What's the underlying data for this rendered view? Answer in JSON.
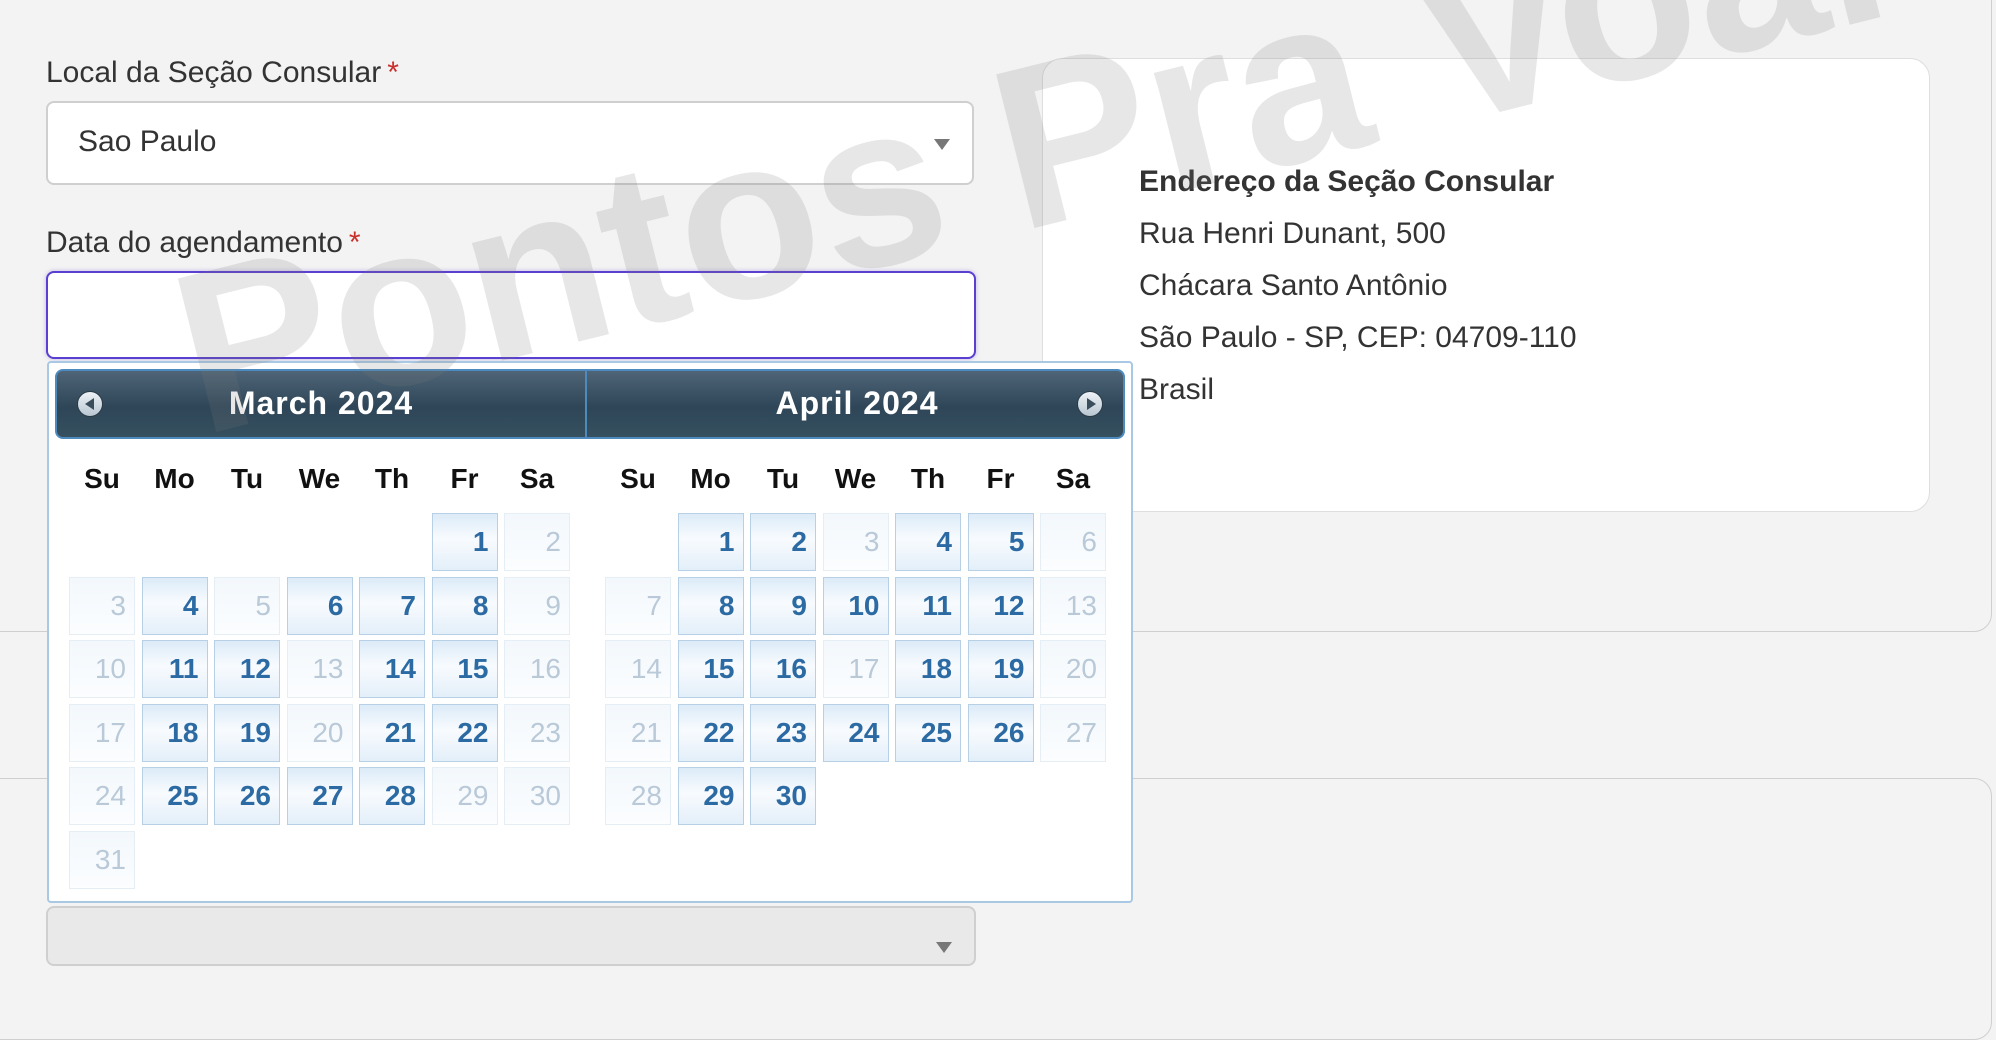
{
  "form": {
    "local_label": "Local da Seção Consular",
    "local_required": "*",
    "local_value": "Sao Paulo",
    "date_label": "Data do agendamento",
    "date_required": "*",
    "date_value": ""
  },
  "address": {
    "title": "Endereço da Seção Consular",
    "line1": "Rua Henri Dunant, 500",
    "line2": "Chácara Santo Antônio",
    "line3": "São Paulo - SP, CEP: 04709-110",
    "line4": "Brasil"
  },
  "datepicker": {
    "weekdays": [
      "Su",
      "Mo",
      "Tu",
      "We",
      "Th",
      "Fr",
      "Sa"
    ],
    "months": [
      {
        "title": "March 2024",
        "weeks": [
          [
            null,
            null,
            null,
            null,
            null,
            1,
            2
          ],
          [
            3,
            4,
            5,
            6,
            7,
            8,
            9
          ],
          [
            10,
            11,
            12,
            13,
            14,
            15,
            16
          ],
          [
            17,
            18,
            19,
            20,
            21,
            22,
            23
          ],
          [
            24,
            25,
            26,
            27,
            28,
            29,
            30
          ],
          [
            31,
            null,
            null,
            null,
            null,
            null,
            null
          ]
        ],
        "available": [
          1,
          4,
          6,
          7,
          8,
          11,
          12,
          14,
          15,
          18,
          19,
          21,
          22,
          25,
          26,
          27,
          28
        ]
      },
      {
        "title": "April 2024",
        "weeks": [
          [
            null,
            1,
            2,
            3,
            4,
            5,
            6
          ],
          [
            7,
            8,
            9,
            10,
            11,
            12,
            13
          ],
          [
            14,
            15,
            16,
            17,
            18,
            19,
            20
          ],
          [
            21,
            22,
            23,
            24,
            25,
            26,
            27
          ],
          [
            28,
            29,
            30,
            null,
            null,
            null,
            null
          ]
        ],
        "available": [
          1,
          2,
          4,
          5,
          8,
          9,
          10,
          11,
          12,
          15,
          16,
          18,
          19,
          22,
          23,
          24,
          25,
          26,
          29,
          30
        ]
      }
    ],
    "prev_icon": "circle-arrow-left-icon",
    "next_icon": "circle-arrow-right-icon"
  },
  "watermark": "Pontos Pra Voar",
  "colors": {
    "header_bg": "#2e4658",
    "available_text": "#2b6aa3",
    "unavailable_text": "#b9c9d8",
    "focus_border": "#5b3fd0",
    "required": "#c9302c"
  }
}
